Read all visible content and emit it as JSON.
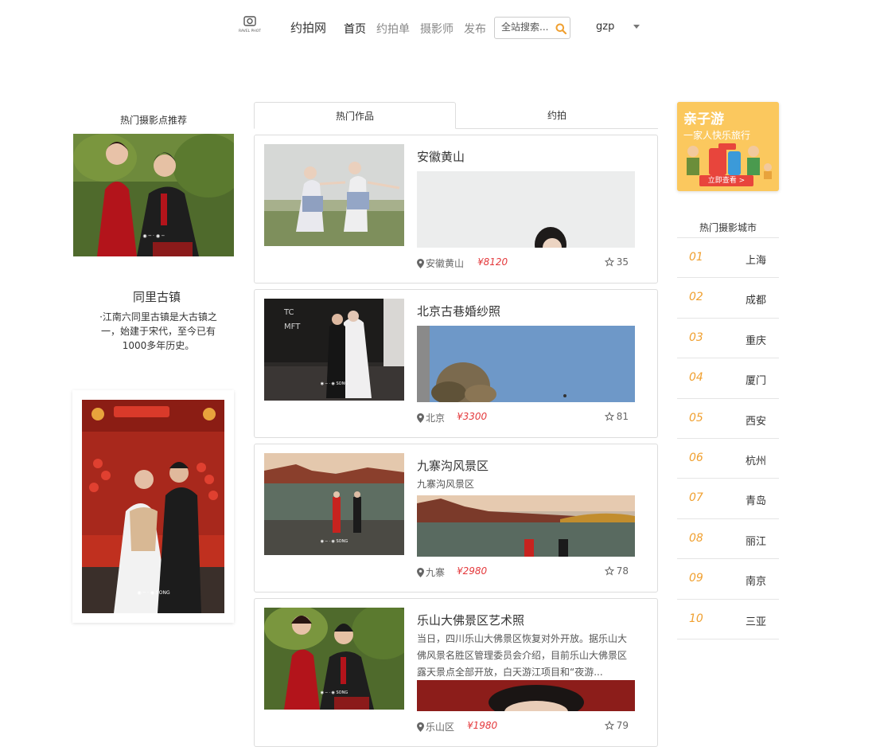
{
  "header": {
    "site_name": "约拍网",
    "nav": [
      {
        "label": "首页",
        "active": true
      },
      {
        "label": "约拍单",
        "active": false
      },
      {
        "label": "摄影师",
        "active": false
      },
      {
        "label": "发布",
        "active": false
      }
    ],
    "search_placeholder": "全站搜索...",
    "username": "gzp",
    "logo_text": "RAVEL PHOT"
  },
  "left": {
    "title": "热门摄影点推荐",
    "spot_name": "同里古镇",
    "spot_desc": "·江南六同里古镇是大古镇之一，始建于宋代，至今已有1000多年历史。"
  },
  "tabs": [
    {
      "label": "热门作品",
      "active": true
    },
    {
      "label": "约拍",
      "active": false
    }
  ],
  "works": [
    {
      "title": "安徽黄山",
      "desc": "",
      "location": "安徽黄山",
      "price": "¥8120",
      "likes": "35"
    },
    {
      "title": "北京古巷婚纱照",
      "desc": "",
      "location": "北京",
      "price": "¥3300",
      "likes": "81"
    },
    {
      "title": "九寨沟风景区",
      "desc": "九寨沟风景区",
      "location": "九寨",
      "price": "¥2980",
      "likes": "78"
    },
    {
      "title": "乐山大佛景区艺术照",
      "desc": "当日，四川乐山大佛景区恢复对外开放。据乐山大佛风景名胜区管理委员会介绍，目前乐山大佛景区露天景点全部开放，白天游江项目和“夜游...",
      "location": "乐山区",
      "price": "¥1980",
      "likes": "79"
    }
  ],
  "ad": {
    "title": "亲子游",
    "subtitle": "一家人快乐旅行",
    "button": "立即查看 >"
  },
  "cities": {
    "title": "热门摄影城市",
    "items": [
      {
        "num": "01",
        "name": "上海"
      },
      {
        "num": "02",
        "name": "成都"
      },
      {
        "num": "03",
        "name": "重庆"
      },
      {
        "num": "04",
        "name": "厦门"
      },
      {
        "num": "05",
        "name": "西安"
      },
      {
        "num": "06",
        "name": "杭州"
      },
      {
        "num": "07",
        "name": "青岛"
      },
      {
        "num": "08",
        "name": "丽江"
      },
      {
        "num": "09",
        "name": "南京"
      },
      {
        "num": "10",
        "name": "三亚"
      }
    ]
  },
  "colors": {
    "price": "#e4393c",
    "city_num": "#f0a030",
    "search_icon": "#f0a030"
  }
}
